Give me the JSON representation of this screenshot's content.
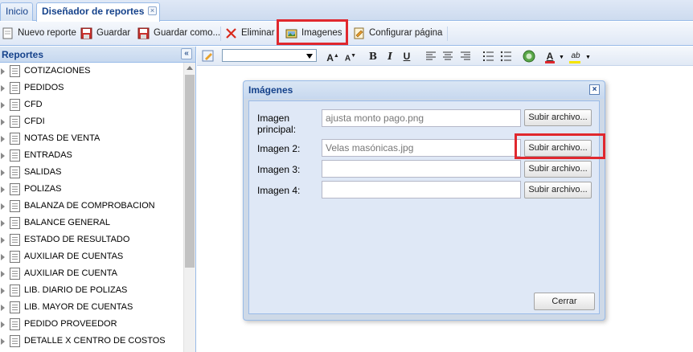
{
  "tabs": [
    {
      "label": "Inicio"
    },
    {
      "label": "Diseñador de reportes",
      "close": "×"
    }
  ],
  "toolbar": {
    "items": [
      {
        "label": "Nuevo reporte",
        "icon": "new-report-icon"
      },
      {
        "label": "Guardar",
        "icon": "save-icon"
      },
      {
        "label": "Guardar como...",
        "icon": "save-as-icon"
      },
      {
        "label": "Eliminar",
        "icon": "delete-x-icon"
      },
      {
        "label": "Imagenes",
        "icon": "images-icon"
      },
      {
        "label": "Configurar página",
        "icon": "page-setup-icon"
      }
    ]
  },
  "sidebar": {
    "title": "Reportes",
    "collapse": "«",
    "items": [
      {
        "label": "COTIZACIONES"
      },
      {
        "label": "PEDIDOS"
      },
      {
        "label": "CFD"
      },
      {
        "label": "CFDI"
      },
      {
        "label": "NOTAS DE VENTA"
      },
      {
        "label": "ENTRADAS"
      },
      {
        "label": "SALIDAS"
      },
      {
        "label": "POLIZAS"
      },
      {
        "label": "BALANZA DE COMPROBACION"
      },
      {
        "label": "BALANCE GENERAL"
      },
      {
        "label": "ESTADO DE RESULTADO"
      },
      {
        "label": "AUXILIAR DE CUENTAS"
      },
      {
        "label": "AUXILIAR DE CUENTA"
      },
      {
        "label": "LIB. DIARIO DE POLIZAS"
      },
      {
        "label": "LIB. MAYOR DE CUENTAS"
      },
      {
        "label": "PEDIDO PROVEEDOR"
      },
      {
        "label": "DETALLE X CENTRO DE COSTOS"
      }
    ]
  },
  "editor_toolbar": {
    "font_select_value": "",
    "buttons": {
      "grow": "A",
      "shrink": "A",
      "bold": "B",
      "italic": "I",
      "underline": "U",
      "font_color": "A",
      "highlight": "ab"
    },
    "colors": {
      "font_color": "#e0282e",
      "highlight": "#f5e400"
    }
  },
  "dialog": {
    "title": "Imágenes",
    "close": "×",
    "rows": [
      {
        "label": "Imagen principal:",
        "value": "ajusta monto pago.png",
        "button": "Subir archivo..."
      },
      {
        "label": "Imagen 2:",
        "value": "Velas masónicas.jpg",
        "button": "Subir archivo..."
      },
      {
        "label": "Imagen 3:",
        "value": "",
        "button": "Subir archivo..."
      },
      {
        "label": "Imagen 4:",
        "value": "",
        "button": "Subir archivo..."
      }
    ],
    "close_button": "Cerrar"
  },
  "highlight_color": "#e0282e"
}
